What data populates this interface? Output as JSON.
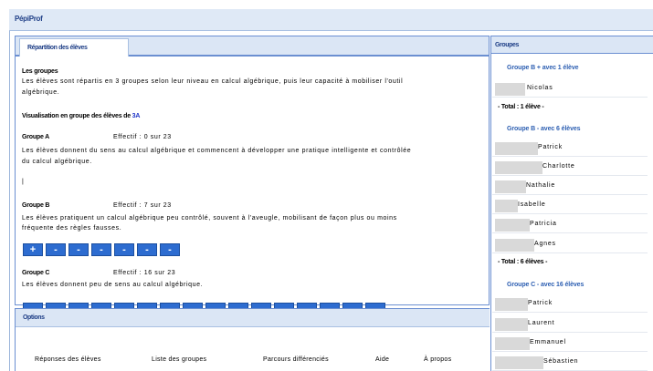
{
  "app": {
    "title": "PépiProf"
  },
  "main": {
    "tab_label": "Répartition des élèves",
    "intro": {
      "heading": "Les groupes",
      "line1": "Les élèves sont répartis en 3 groupes selon leur niveau en calcul algébrique, puis leur capacité à mobiliser l'outil",
      "line2": "algébrique."
    },
    "visualisation": {
      "label": "Visualisation en groupe des élèves de",
      "class_link": "3A"
    },
    "groups": [
      {
        "name": "Groupe A",
        "effectif": "Effectif : 0 sur 23",
        "line1": "Les élèves donnent du sens au calcul algébrique et commencent à développer une pratique intelligente et contrôlée",
        "line2": "du calcul algébrique.",
        "marker": "|"
      },
      {
        "name": "Groupe B",
        "effectif": "Effectif : 7 sur 23",
        "line1": "Les élèves pratiquent un calcul algébrique peu contrôlé, souvent à l'aveugle, mobilisant de façon plus ou moins",
        "line2": "fréquente des règles fausses.",
        "buttons": [
          "+",
          "-",
          "-",
          "-",
          "-",
          "-",
          "-"
        ]
      },
      {
        "name": "Groupe C",
        "effectif": "Effectif : 16 sur 23",
        "line1": "Les élèves donnent peu de sens au calcul algébrique.",
        "buttons": [
          "-",
          "-",
          "-",
          "-",
          "-",
          "-",
          "-",
          "-",
          "-",
          "-",
          "-",
          "-",
          "-",
          "-",
          "-",
          "-"
        ]
      }
    ]
  },
  "options": {
    "title": "Options",
    "links": [
      "Réponses des élèves",
      "Liste des groupes",
      "Parcours différenciés",
      "Aide",
      "À propos"
    ]
  },
  "side": {
    "title": "Groupes",
    "groups": [
      {
        "title": "Groupe B + avec 1 élève",
        "students": [
          "Nicolas"
        ],
        "total": "- Total : 1 élève -"
      },
      {
        "title": "Groupe B - avec 6 élèves",
        "students": [
          "Patrick",
          "Charlotte",
          "Nathalie",
          "Isabelle",
          "Patricia",
          "Agnes"
        ],
        "total": "- Total : 6 élèves -"
      },
      {
        "title": "Groupe C - avec 16 élèves",
        "students": [
          "Patrick",
          "Laurent",
          "Emmanuel",
          "Sébastien"
        ]
      }
    ]
  },
  "colors": {
    "accent": "#2d6cd0",
    "panel_header": "#dbe6f5",
    "title_text": "#1f3f87"
  }
}
